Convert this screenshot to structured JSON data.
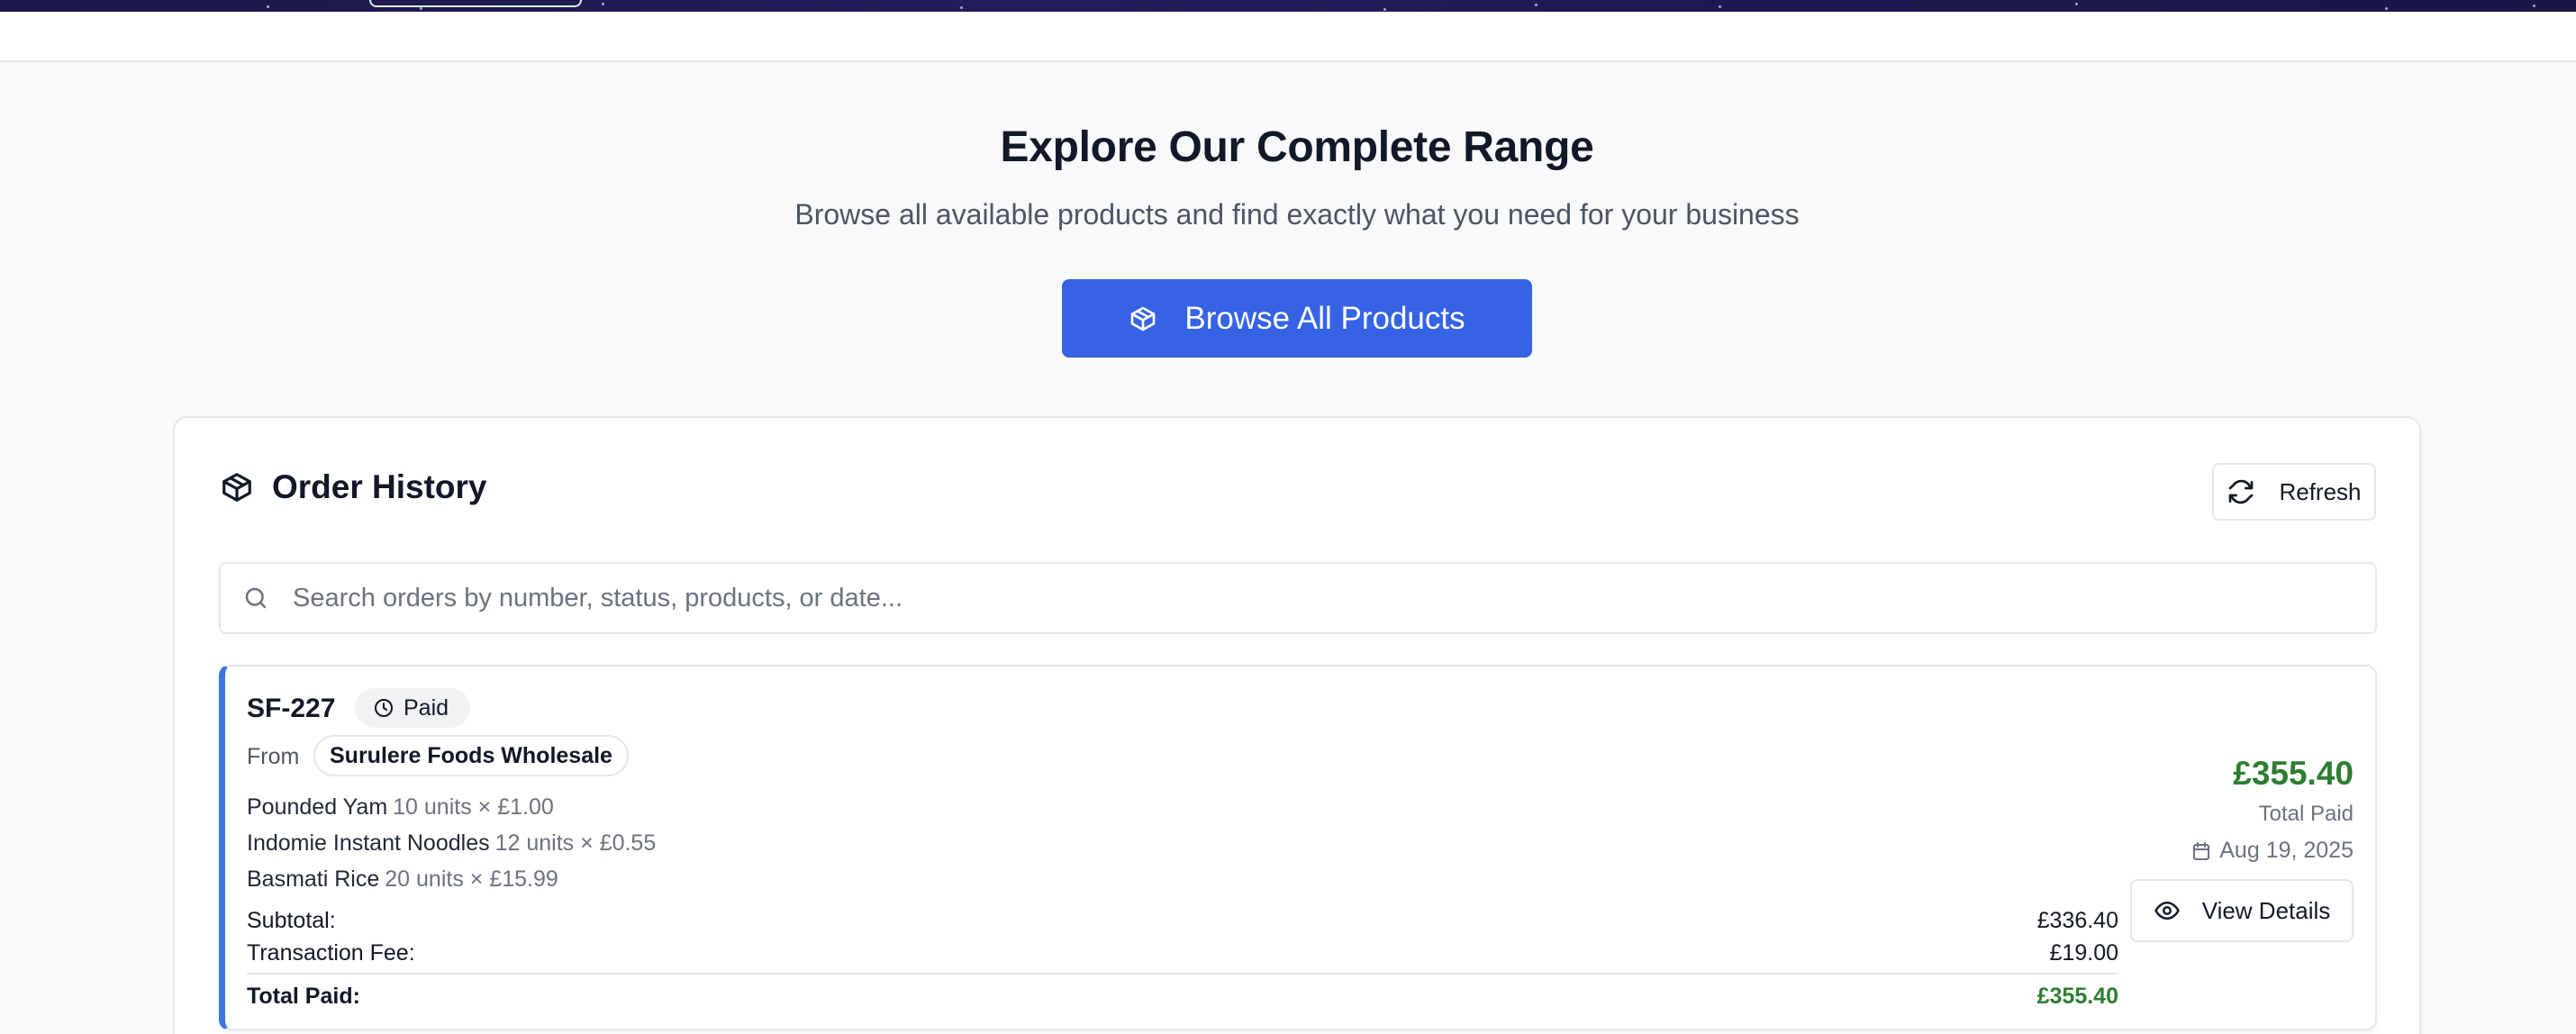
{
  "hero": {
    "title": "Explore Our Complete Range",
    "subtitle": "Browse all available products and find exactly what you need for your business",
    "browse_label": "Browse All Products"
  },
  "order_history": {
    "title": "Order History",
    "refresh_label": "Refresh",
    "search_placeholder": "Search orders by number, status, products, or date...",
    "orders": [
      {
        "number": "SF-227",
        "status": "Paid",
        "from_label": "From",
        "supplier": "Surulere Foods Wholesale",
        "items": [
          {
            "name": "Pounded Yam",
            "qty": "10 units × £1.00"
          },
          {
            "name": "Indomie Instant Noodles",
            "qty": "12 units × £0.55"
          },
          {
            "name": "Basmati Rice",
            "qty": "20 units × £15.99"
          }
        ],
        "subtotal_label": "Subtotal:",
        "subtotal": "£336.40",
        "fee_label": "Transaction Fee:",
        "fee": "£19.00",
        "total_label": "Total Paid:",
        "total": "£355.40",
        "amount": "£355.40",
        "amount_label": "Total Paid",
        "date": "Aug 19, 2025",
        "view_label": "View Details"
      }
    ]
  },
  "icons": {
    "browse": "package-icon",
    "history": "package-icon",
    "refresh": "refresh-icon",
    "search": "search-icon",
    "status": "clock-icon",
    "date": "calendar-icon",
    "view": "eye-icon"
  },
  "colors": {
    "primary": "#3563e3",
    "accent_border": "#3b76e3",
    "success": "#2e7d32",
    "header_band": "#1b1748"
  }
}
